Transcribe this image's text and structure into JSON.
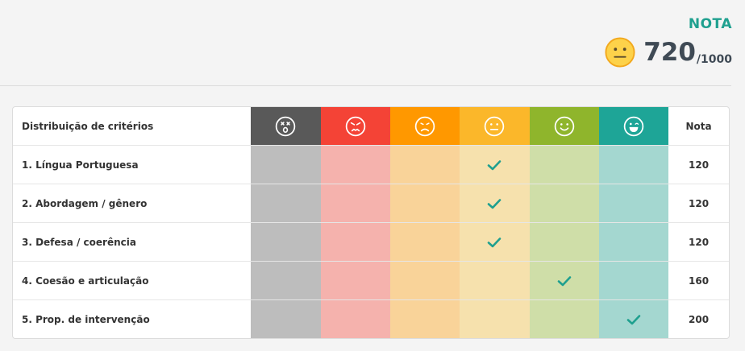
{
  "score": {
    "label": "NOTA",
    "value": "720",
    "max": "/1000",
    "icon": "neutral-face-icon"
  },
  "table": {
    "header": {
      "label": "Distribuição de critérios",
      "nota_label": "Nota",
      "levels": [
        {
          "icon": "dead-face-icon",
          "color": "#595959",
          "cell_color": "#bdbdbd"
        },
        {
          "icon": "angry-face-icon",
          "color": "#f44336",
          "cell_color": "#f5b2ad"
        },
        {
          "icon": "sad-face-icon",
          "color": "#ff9800",
          "cell_color": "#f9d399"
        },
        {
          "icon": "neutral-face-icon",
          "color": "#fbb72a",
          "cell_color": "#f6e1ad"
        },
        {
          "icon": "smile-face-icon",
          "color": "#8fb52c",
          "cell_color": "#cfdea8"
        },
        {
          "icon": "laugh-face-icon",
          "color": "#1ea597",
          "cell_color": "#a4d7d0"
        }
      ]
    },
    "rows": [
      {
        "label": "1. Língua Portuguesa",
        "level": 3,
        "nota": "120"
      },
      {
        "label": "2. Abordagem / gênero",
        "level": 3,
        "nota": "120"
      },
      {
        "label": "3. Defesa / coerência",
        "level": 3,
        "nota": "120"
      },
      {
        "label": "4. Coesão e articulação",
        "level": 4,
        "nota": "160"
      },
      {
        "label": "5. Prop. de intervenção",
        "level": 5,
        "nota": "200"
      }
    ],
    "check_color": "#1fa08f"
  }
}
